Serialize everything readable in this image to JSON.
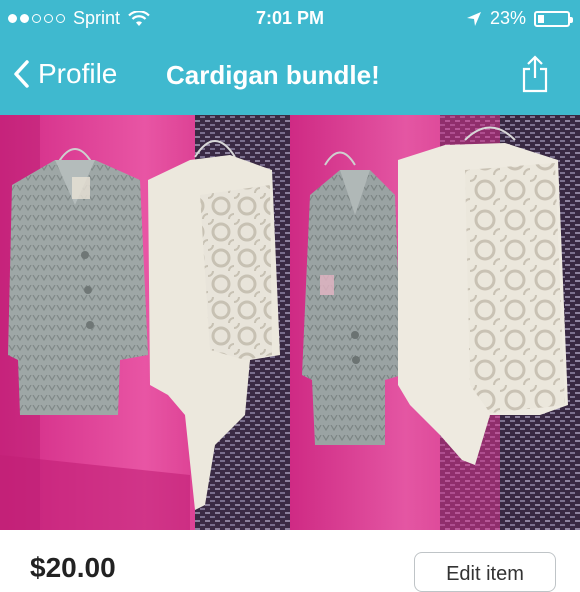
{
  "status_bar": {
    "carrier": "Sprint",
    "time": "7:01 PM",
    "battery_percent": "23%",
    "signal_icon": "signal-dots-icon",
    "wifi_icon": "wifi-icon",
    "location_icon": "location-arrow-icon",
    "battery_icon": "battery-icon"
  },
  "nav": {
    "back_label": "Profile",
    "title": "Cardigan bundle!",
    "share_icon": "share-icon",
    "background_color": "#3fb9cf"
  },
  "listing": {
    "price": "$20.00",
    "edit_label": "Edit item"
  }
}
